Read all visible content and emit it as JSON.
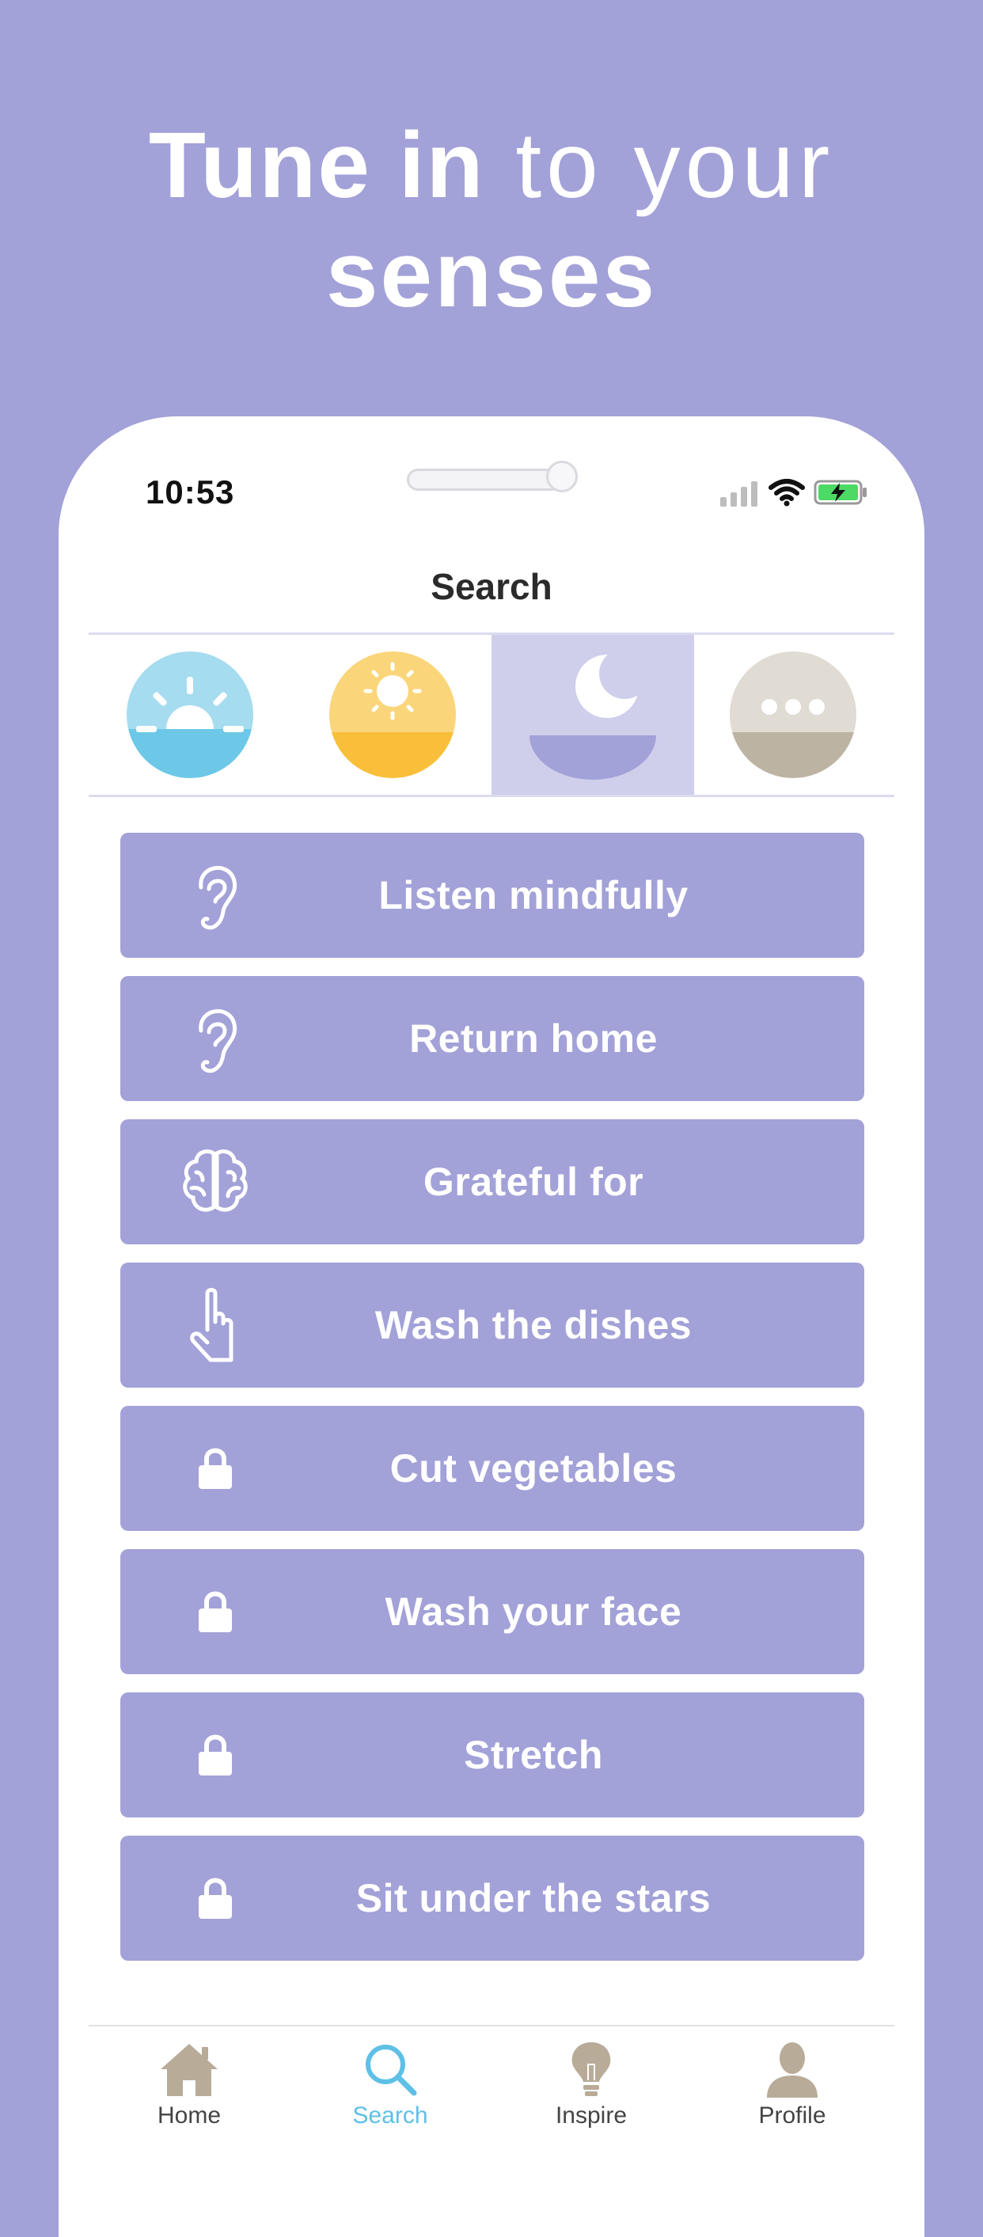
{
  "headline": {
    "line1_bold": "Tune in",
    "line1_light": " to your",
    "line2": "senses"
  },
  "status_bar": {
    "time": "10:53"
  },
  "nav": {
    "title": "Search"
  },
  "segments": [
    {
      "icon": "sunrise-icon",
      "active": false
    },
    {
      "icon": "sun-icon",
      "active": false
    },
    {
      "icon": "moon-icon",
      "active": true
    },
    {
      "icon": "more-icon",
      "active": false
    }
  ],
  "list": {
    "items": [
      {
        "label": "Listen mindfully",
        "icon": "ear-icon",
        "locked": false
      },
      {
        "label": "Return home",
        "icon": "ear-icon",
        "locked": false
      },
      {
        "label": "Grateful for",
        "icon": "brain-icon",
        "locked": false
      },
      {
        "label": "Wash the dishes",
        "icon": "hand-pointer-icon",
        "locked": false
      },
      {
        "label": "Cut vegetables",
        "icon": "lock-icon",
        "locked": true
      },
      {
        "label": "Wash your face",
        "icon": "lock-icon",
        "locked": true
      },
      {
        "label": "Stretch",
        "icon": "lock-icon",
        "locked": true
      },
      {
        "label": "Sit under the stars",
        "icon": "lock-icon",
        "locked": true
      }
    ]
  },
  "tabbar": {
    "tabs": [
      {
        "label": "Home",
        "icon": "home-icon"
      },
      {
        "label": "Search",
        "icon": "search-icon",
        "active": true
      },
      {
        "label": "Inspire",
        "icon": "lightbulb-icon"
      },
      {
        "label": "Profile",
        "icon": "person-icon"
      }
    ]
  },
  "colors": {
    "background": "#a2a1d8",
    "row": "#a2a1d8",
    "active_segment": "#cfcfec",
    "tab_active": "#5ec0e6",
    "tab_icon": "#b8ab98"
  }
}
